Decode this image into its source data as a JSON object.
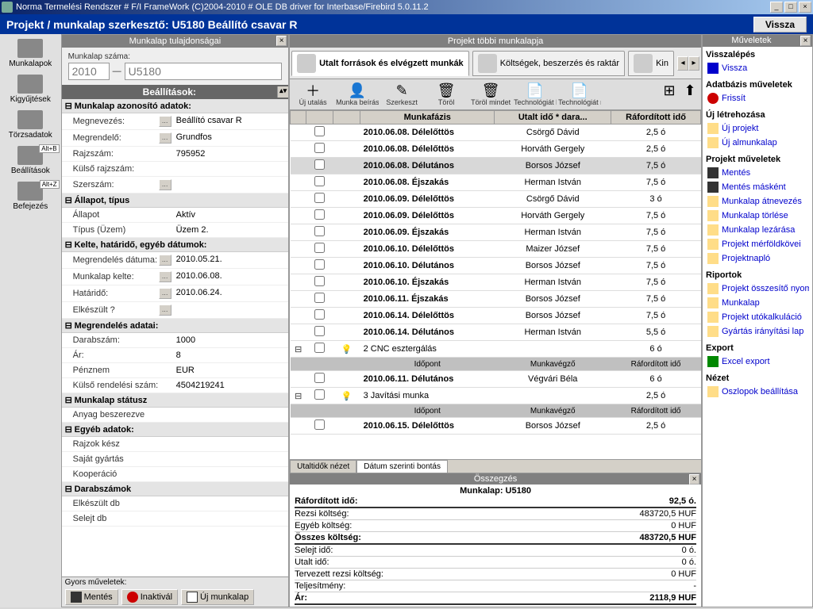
{
  "titlebar": "Norma Termelési Rendszer # F/I FrameWork (C)2004-2010 # OLE DB driver for Interbase/Firebird 5.0.11.2",
  "header": {
    "title": "Projekt / munkalap szerkesztő: U5180 Beállító csavar R",
    "back": "Vissza"
  },
  "nav": [
    {
      "label": "Munkalapok"
    },
    {
      "label": "Kigyűjtések"
    },
    {
      "label": "Törzsadatok"
    },
    {
      "label": "Beállítások",
      "kbd": "Alt+B"
    },
    {
      "label": "Befejezés",
      "kbd": "Alt+Z"
    }
  ],
  "left": {
    "title": "Munkalap tulajdonságai",
    "szama": {
      "label": "Munkalap száma:",
      "year": "2010",
      "num": "U5180"
    },
    "section": "Beállítások:",
    "groups": [
      {
        "title": "Munkalap azonosító adatok:",
        "rows": [
          {
            "k": "Megnevezés:",
            "v": "Beállító csavar R",
            "dots": true
          },
          {
            "k": "Megrendelő:",
            "v": "Grundfos",
            "dots": true
          },
          {
            "k": "Rajzszám:",
            "v": "795952"
          },
          {
            "k": "Külső rajzszám:",
            "v": ""
          },
          {
            "k": "Szerszám:",
            "v": "",
            "dots": true
          }
        ]
      },
      {
        "title": "Állapot, típus",
        "rows": [
          {
            "k": "Állapot",
            "v": "Aktív"
          },
          {
            "k": "Típus (Üzem)",
            "v": "Üzem 2."
          }
        ]
      },
      {
        "title": "Kelte, határidő, egyéb dátumok:",
        "rows": [
          {
            "k": "Megrendelés dátuma:",
            "v": "2010.05.21.",
            "dots": true
          },
          {
            "k": "Munkalap kelte:",
            "v": "2010.06.08.",
            "dots": true
          },
          {
            "k": "Határidő:",
            "v": "2010.06.24.",
            "dots": true
          },
          {
            "k": "Elkészült ?",
            "v": "",
            "dots": true
          }
        ]
      },
      {
        "title": "Megrendelés adatai:",
        "rows": [
          {
            "k": "Darabszám:",
            "v": "1000"
          },
          {
            "k": "Ár:",
            "v": "8"
          },
          {
            "k": "Pénznem",
            "v": "EUR"
          },
          {
            "k": "Külső rendelési szám:",
            "v": "4504219241"
          }
        ]
      },
      {
        "title": "Munkalap státusz",
        "rows": [
          {
            "k": "Anyag beszerezve",
            "v": ""
          }
        ]
      },
      {
        "title": "Egyéb adatok:",
        "rows": [
          {
            "k": "Rajzok kész",
            "v": ""
          },
          {
            "k": "Saját gyártás",
            "v": ""
          },
          {
            "k": "Kooperáció",
            "v": ""
          }
        ]
      },
      {
        "title": "Darabszámok",
        "rows": [
          {
            "k": "Elkészült db",
            "v": ""
          },
          {
            "k": "Selejt db",
            "v": ""
          }
        ]
      }
    ],
    "quick": {
      "title": "Gyors műveletek:",
      "save": "Mentés",
      "inact": "Inaktivál",
      "new": "Új munkalap"
    }
  },
  "center": {
    "title": "Projekt többi munkalapja",
    "tabs": [
      {
        "label": "Utalt források és elvégzett munkák",
        "active": true
      },
      {
        "label": "Költségek, beszerzés és raktár"
      },
      {
        "label": "Kin"
      }
    ],
    "toolbar": [
      {
        "label": "Új utalás",
        "icon": "＋"
      },
      {
        "label": "Munka beírása",
        "icon": "👤"
      },
      {
        "label": "Szerkeszt",
        "icon": "✎"
      },
      {
        "label": "Töröl",
        "icon": "🗑"
      },
      {
        "label": "Töröl mindet",
        "icon": "🗑"
      },
      {
        "label": "Technológiát betölt",
        "icon": "📄"
      },
      {
        "label": "Technológiát ment",
        "icon": "📄"
      }
    ],
    "header_cols": [
      "Munkafázis",
      "Utalt idő * dara...",
      "Ráfordított idő"
    ],
    "rows": [
      {
        "phase": "2010.06.08. Délelőttös",
        "user": "Csörgő Dávid",
        "h": "2,5 ó",
        "shade": false
      },
      {
        "phase": "2010.06.08. Délelőttös",
        "user": "Horváth Gergely",
        "h": "2,5 ó",
        "shade": false
      },
      {
        "phase": "2010.06.08. Délutános",
        "user": "Borsos József",
        "h": "7,5 ó",
        "shade": true
      },
      {
        "phase": "2010.06.08. Éjszakás",
        "user": "Herman István",
        "h": "7,5 ó",
        "shade": false
      },
      {
        "phase": "2010.06.09. Délelőttös",
        "user": "Csörgő Dávid",
        "h": "3 ó",
        "shade": false
      },
      {
        "phase": "2010.06.09. Délelőttös",
        "user": "Horváth Gergely",
        "h": "7,5 ó",
        "shade": false
      },
      {
        "phase": "2010.06.09. Éjszakás",
        "user": "Herman István",
        "h": "7,5 ó",
        "shade": false
      },
      {
        "phase": "2010.06.10. Délelőttös",
        "user": "Maizer József",
        "h": "7,5 ó",
        "shade": false
      },
      {
        "phase": "2010.06.10. Délutános",
        "user": "Borsos József",
        "h": "7,5 ó",
        "shade": false
      },
      {
        "phase": "2010.06.10. Éjszakás",
        "user": "Herman István",
        "h": "7,5 ó",
        "shade": false
      },
      {
        "phase": "2010.06.11. Éjszakás",
        "user": "Borsos József",
        "h": "7,5 ó",
        "shade": false
      },
      {
        "phase": "2010.06.14. Délelőttös",
        "user": "Borsos József",
        "h": "7,5 ó",
        "shade": false
      },
      {
        "phase": "2010.06.14. Délutános",
        "user": "Herman István",
        "h": "5,5 ó",
        "shade": false
      }
    ],
    "grp1": {
      "title": "2 CNC esztergálás",
      "h": "6 ó",
      "sub_cols": [
        "Időpont",
        "Munkavégző",
        "Ráfordított idő"
      ],
      "rows": [
        {
          "phase": "2010.06.11. Délutános",
          "user": "Végvári Béla",
          "h": "6 ó",
          "shade": false
        }
      ]
    },
    "grp2": {
      "title": "3 Javítási munka",
      "h": "2,5 ó",
      "sub_cols": [
        "Időpont",
        "Munkavégző",
        "Ráfordított idő"
      ],
      "rows": [
        {
          "phase": "2010.06.15. Délelőttös",
          "user": "Borsos József",
          "h": "2,5 ó",
          "shade": false
        }
      ]
    },
    "bottom_tabs": [
      "Utaltidők nézet",
      "Dátum szerinti bontás"
    ],
    "summary": {
      "title": "Összegzés",
      "sheet": "Munkalap: U5180",
      "rows": [
        {
          "k": "Ráfordított idő:",
          "v": "92,5 ó.",
          "bold": true
        },
        {
          "k": "Rezsi költség:",
          "v": "483720,5 HUF"
        },
        {
          "k": "Egyéb költség:",
          "v": "0 HUF"
        },
        {
          "k": "Összes költség:",
          "v": "483720,5 HUF",
          "bold": true
        },
        {
          "k": "Selejt idő:",
          "v": "0 ó."
        },
        {
          "k": "Utalt idő:",
          "v": "0 ó."
        },
        {
          "k": "Tervezett rezsi költség:",
          "v": "0 HUF"
        },
        {
          "k": "Teljesítmény:",
          "v": "-"
        },
        {
          "k": "Ár:",
          "v": "2118,9 HUF",
          "bold": true
        }
      ]
    }
  },
  "right": {
    "title": "Műveletek",
    "sections": [
      {
        "title": "Visszalépés",
        "links": [
          {
            "t": "Vissza",
            "icon": "arrow"
          }
        ]
      },
      {
        "title": "Adatbázis műveletek",
        "links": [
          {
            "t": "Frissít",
            "icon": "refresh"
          }
        ]
      },
      {
        "title": "Új létrehozása",
        "links": [
          {
            "t": "Új projekt",
            "icon": "page"
          },
          {
            "t": "Új almunkalap",
            "icon": "page"
          }
        ]
      },
      {
        "title": "Projekt műveletek",
        "links": [
          {
            "t": "Mentés",
            "icon": "floppy"
          },
          {
            "t": "Mentés másként",
            "icon": "floppy"
          },
          {
            "t": "Munkalap átnevezés",
            "icon": "page"
          },
          {
            "t": "Munkalap törlése",
            "icon": "page"
          },
          {
            "t": "Munkalap lezárása",
            "icon": "page"
          },
          {
            "t": "Projekt mérföldkövei",
            "icon": "page"
          },
          {
            "t": "Projektnapló",
            "icon": "page"
          }
        ]
      },
      {
        "title": "Riportok",
        "links": [
          {
            "t": "Projekt összesítő nyomtatás",
            "icon": "page"
          },
          {
            "t": "Munkalap",
            "icon": "page"
          },
          {
            "t": "Projekt utókalkuláció",
            "icon": "page"
          },
          {
            "t": "Gyártás irányítási lap",
            "icon": "page"
          }
        ]
      },
      {
        "title": "Export",
        "links": [
          {
            "t": "Excel export",
            "icon": "excel"
          }
        ]
      },
      {
        "title": "Nézet",
        "links": [
          {
            "t": "Oszlopok beállítása",
            "icon": "page"
          }
        ]
      }
    ]
  }
}
